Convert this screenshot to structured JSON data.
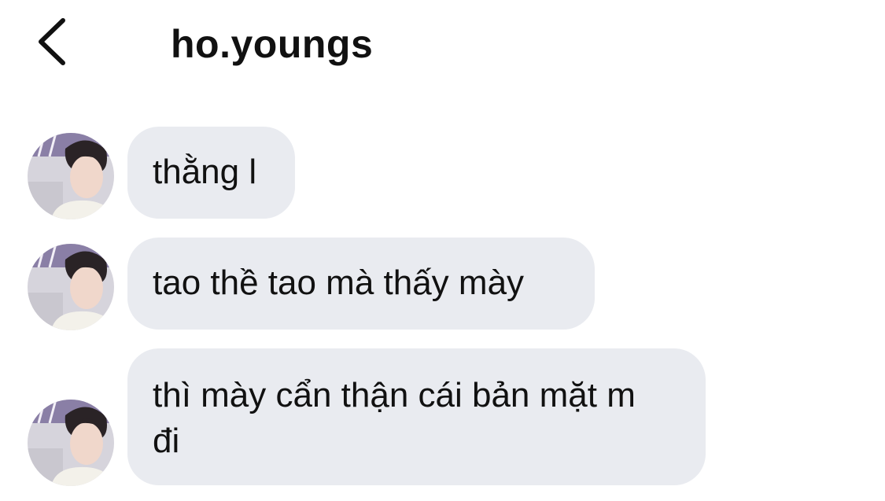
{
  "header": {
    "back_icon": "chevron-left-icon",
    "title": "ho.youngs"
  },
  "messages": [
    {
      "sender": "ho.youngs",
      "avatar_icon": "avatar-photo",
      "text": "thằng l"
    },
    {
      "sender": "ho.youngs",
      "avatar_icon": "avatar-photo",
      "text": "tao thề tao mà thấy mày"
    },
    {
      "sender": "ho.youngs",
      "avatar_icon": "avatar-photo",
      "text": "thì mày cẩn thận cái bản mặt m đi"
    }
  ],
  "colors": {
    "background": "#ffffff",
    "bubble": "#e9ebf0",
    "text": "#111111"
  }
}
